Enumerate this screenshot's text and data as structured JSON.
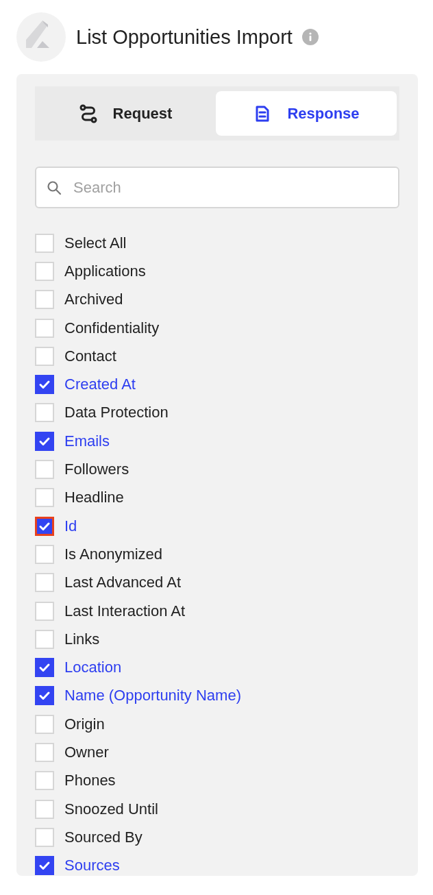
{
  "header": {
    "title": "List Opportunities Import"
  },
  "tabs": [
    {
      "label": "Request",
      "kind": "request",
      "selected": false
    },
    {
      "label": "Response",
      "kind": "response",
      "selected": true
    }
  ],
  "search": {
    "placeholder": "Search"
  },
  "fields": [
    {
      "label": "Select All",
      "checked": false,
      "focused": false
    },
    {
      "label": "Applications",
      "checked": false,
      "focused": false
    },
    {
      "label": "Archived",
      "checked": false,
      "focused": false
    },
    {
      "label": "Confidentiality",
      "checked": false,
      "focused": false
    },
    {
      "label": "Contact",
      "checked": false,
      "focused": false
    },
    {
      "label": "Created At",
      "checked": true,
      "focused": false
    },
    {
      "label": "Data Protection",
      "checked": false,
      "focused": false
    },
    {
      "label": "Emails",
      "checked": true,
      "focused": false
    },
    {
      "label": "Followers",
      "checked": false,
      "focused": false
    },
    {
      "label": "Headline",
      "checked": false,
      "focused": false
    },
    {
      "label": "Id",
      "checked": true,
      "focused": true
    },
    {
      "label": "Is Anonymized",
      "checked": false,
      "focused": false
    },
    {
      "label": "Last Advanced At",
      "checked": false,
      "focused": false
    },
    {
      "label": "Last Interaction At",
      "checked": false,
      "focused": false
    },
    {
      "label": "Links",
      "checked": false,
      "focused": false
    },
    {
      "label": "Location",
      "checked": true,
      "focused": false
    },
    {
      "label": "Name (Opportunity Name)",
      "checked": true,
      "focused": false
    },
    {
      "label": "Origin",
      "checked": false,
      "focused": false
    },
    {
      "label": "Owner",
      "checked": false,
      "focused": false
    },
    {
      "label": "Phones",
      "checked": false,
      "focused": false
    },
    {
      "label": "Snoozed Until",
      "checked": false,
      "focused": false
    },
    {
      "label": "Sourced By",
      "checked": false,
      "focused": false
    },
    {
      "label": "Sources",
      "checked": true,
      "focused": false
    }
  ]
}
